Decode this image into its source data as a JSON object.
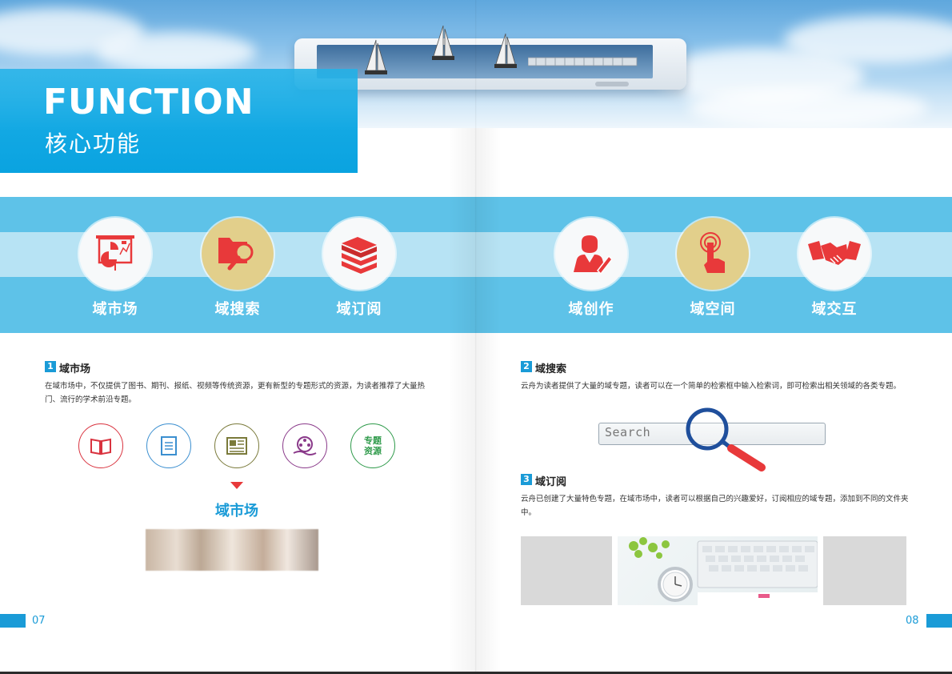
{
  "header": {
    "title_en": "FUNCTION",
    "title_cn": "核心功能"
  },
  "features": [
    {
      "label": "域市场",
      "icon": "presentation-chart-icon"
    },
    {
      "label": "域搜索",
      "icon": "folder-search-icon"
    },
    {
      "label": "域订阅",
      "icon": "books-icon"
    },
    {
      "label": "域创作",
      "icon": "writer-icon"
    },
    {
      "label": "域空间",
      "icon": "touch-icon"
    },
    {
      "label": "域交互",
      "icon": "handshake-icon"
    }
  ],
  "section1": {
    "num": "1",
    "title": "域市场",
    "text": "在域市场中，不仅提供了图书、期刊、报纸、视频等传统资源，更有新型的专题形式的资源，为读者推荐了大量热门、流行的学术前沿专题。",
    "icons": [
      {
        "name": "book-icon",
        "color": "#d9333f"
      },
      {
        "name": "document-icon",
        "color": "#3b8fd0"
      },
      {
        "name": "newspaper-icon",
        "color": "#7a7a3a"
      },
      {
        "name": "film-icon",
        "color": "#8a3a8a"
      },
      {
        "name": "topic-resource-icon",
        "color": "#2e9a4a",
        "text1": "专题",
        "text2": "资源"
      }
    ],
    "market_label": "域市场"
  },
  "section2": {
    "num": "2",
    "title": "域搜索",
    "text": "云舟为读者提供了大量的域专题，读者可以在一个简单的检索框中输入检索词，即可检索出相关领域的各类专题。",
    "search_placeholder": "Search"
  },
  "section3": {
    "num": "3",
    "title": "域订阅",
    "text": "云舟已创建了大量特色专题，在域市场中，读者可以根据自己的兴趣爱好，订阅相应的域专题，添加到不同的文件夹中。"
  },
  "footer": {
    "page_left": "07",
    "page_right": "08"
  },
  "colors": {
    "accent": "#1a9bd7",
    "band": "#5ec2e8",
    "band_light": "#b7e3f4",
    "icon_red": "#e8393a",
    "highlight": "#e2cf8b"
  }
}
